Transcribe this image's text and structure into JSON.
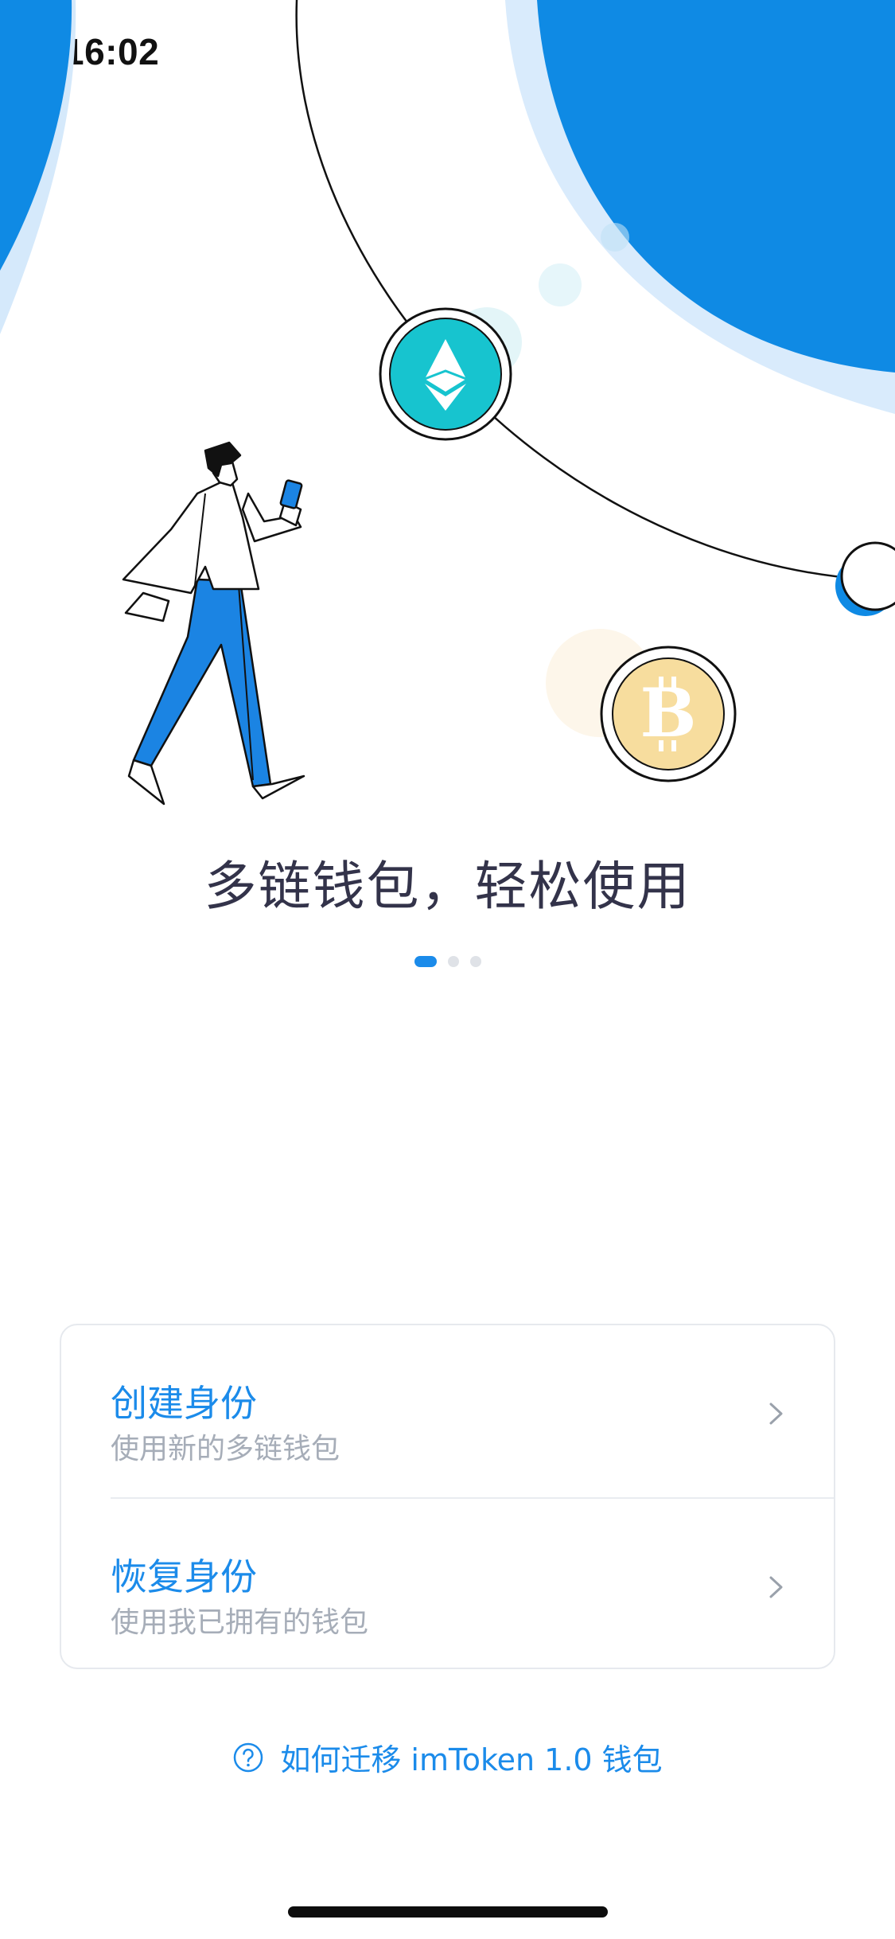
{
  "status_bar": {
    "time": "16:02",
    "icons": [
      "signal-icon",
      "wifi-icon",
      "battery-icon"
    ]
  },
  "hero": {
    "headline": "多链钱包，轻松使用",
    "illustration": [
      "person-walking-with-phone",
      "ethereum-coin-icon",
      "bitcoin-coin-icon",
      "orbit-line"
    ]
  },
  "pager": {
    "count": 3,
    "active_index": 0
  },
  "actions": {
    "create": {
      "title": "创建身份",
      "subtitle": "使用新的多链钱包"
    },
    "restore": {
      "title": "恢复身份",
      "subtitle": "使用我已拥有的钱包"
    }
  },
  "help_link": {
    "label": "如何迁移 imToken 1.0 钱包",
    "icon": "question-circle-icon"
  },
  "colors": {
    "accent": "#1b8bea",
    "heading": "#33334a",
    "subtitle": "#a6adb8",
    "ethereum": "#17c4cf",
    "bitcoin": "#f7dd9e"
  }
}
